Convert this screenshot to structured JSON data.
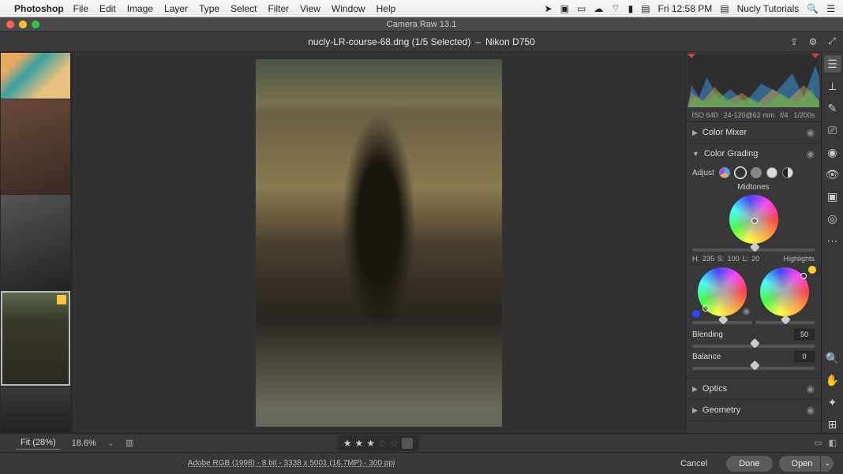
{
  "menubar": {
    "app": "Photoshop",
    "items": [
      "File",
      "Edit",
      "Image",
      "Layer",
      "Type",
      "Select",
      "Filter",
      "View",
      "Window",
      "Help"
    ],
    "clock": "Fri 12:58 PM",
    "user": "Nucly Tutorials"
  },
  "window_title": "Camera Raw 13.1",
  "document": {
    "filename": "nucly-LR-course-68.dng (1/5 Selected)",
    "separator": "–",
    "camera": "Nikon D750"
  },
  "exif": {
    "iso": "ISO 640",
    "focal": "24-120@62 mm",
    "aperture": "f/4",
    "shutter": "1/200s"
  },
  "sections": {
    "color_mixer": {
      "title": "Color Mixer"
    },
    "color_grading": {
      "title": "Color Grading",
      "adjust_label": "Adjust",
      "midtones_label": "Midtones",
      "highlights_label": "Highlights",
      "h_label": "H:",
      "h_val": "235",
      "s_label": "S:",
      "s_val": "100",
      "l_label": "L:",
      "l_val": "20",
      "blending_label": "Blending",
      "blending_val": "50",
      "balance_label": "Balance",
      "balance_val": "0"
    },
    "optics": {
      "title": "Optics"
    },
    "geometry": {
      "title": "Geometry"
    }
  },
  "zoom": {
    "fit": "Fit (28%)",
    "pct": "18.6%"
  },
  "footer": {
    "meta": "Adobe RGB (1998) - 8 bit - 3338 x 5001 (16.7MP) - 300 ppi",
    "cancel": "Cancel",
    "done": "Done",
    "open": "Open"
  },
  "accent": "#2a7fff"
}
